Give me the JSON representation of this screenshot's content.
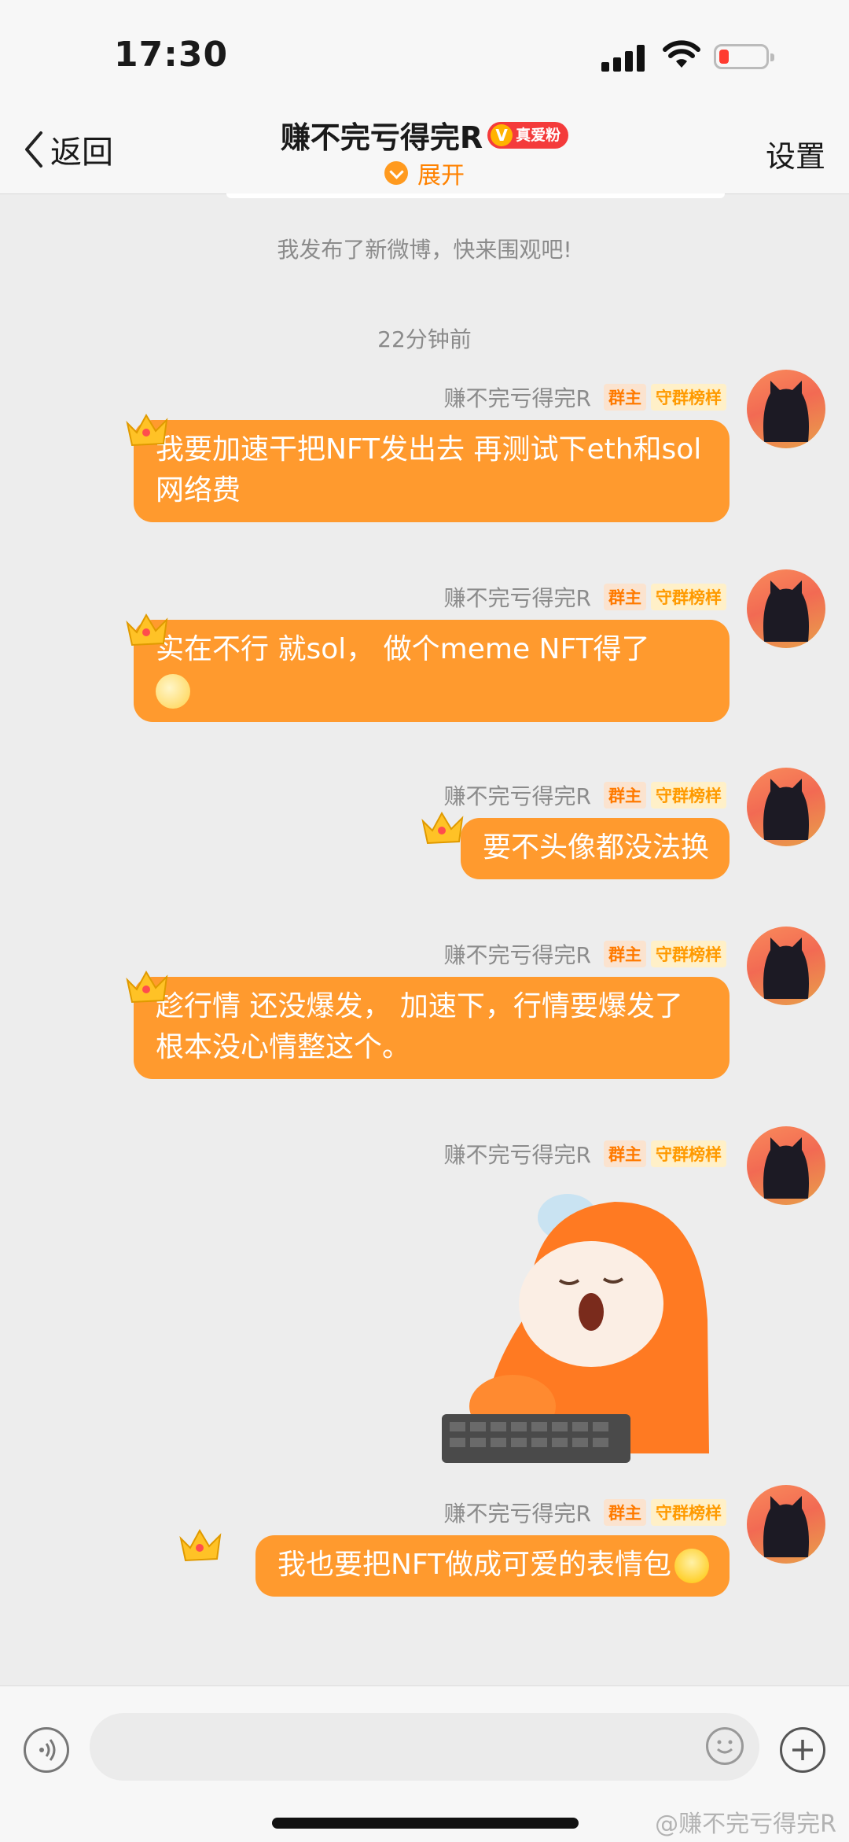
{
  "status_bar": {
    "time": "17:30",
    "battery_level": 0.15,
    "battery_color": "#ff3b30"
  },
  "nav": {
    "back_label": "返回",
    "title": "赚不完亏得完R",
    "badge_label": "真爱粉",
    "expand_label": "展开",
    "settings_label": "设置"
  },
  "system": {
    "post_notice": "我发布了新微博，快来围观吧!",
    "timestamp": "22分钟前"
  },
  "sender": {
    "name": "赚不完亏得完R",
    "tag_owner": "群主",
    "tag_rank": "守群榜样"
  },
  "messages": [
    {
      "text": "我要加速干把NFT发出去 再测试下eth和sol网络费"
    },
    {
      "text": "实在不行 就sol， 做个meme NFT得了",
      "emoji": "dizzy-face-emoji"
    },
    {
      "text": "要不头像都没法换"
    },
    {
      "text": "趁行情 还没爆发， 加速下，行情要爆发了根本没心情整这个。"
    },
    {
      "sticker": "orange-monster-typing-sticker"
    },
    {
      "text": "我也要把NFT做成可爱的表情包",
      "emoji": "pleading-face-emoji"
    }
  ],
  "composer": {
    "placeholder": ""
  },
  "watermark": "@赚不完亏得完R",
  "colors": {
    "bubble": "#ff9a2e",
    "accent": "#ff8200",
    "badge": "#f43b3b"
  }
}
